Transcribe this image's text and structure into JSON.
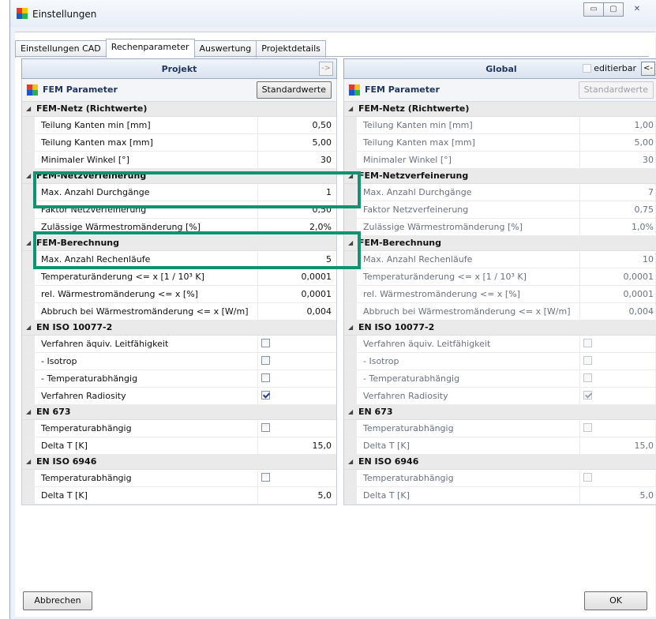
{
  "window": {
    "title": "Einstellungen",
    "buttons": {
      "minimize": "▭",
      "maximize": "▢",
      "close": "✕"
    }
  },
  "tabs": [
    "Einstellungen CAD",
    "Rechenparameter",
    "Auswertung",
    "Projektdetails"
  ],
  "active_tab": "Rechenparameter",
  "left": {
    "title": "Projekt",
    "arrow_label": "->",
    "subheader": "FEM Parameter",
    "standard_button": "Standardwerte",
    "categories": [
      {
        "name": "FEM-Netz (Richtwerte)",
        "rows": [
          {
            "label": "Teilung Kanten min [mm]",
            "value": "0,50"
          },
          {
            "label": "Teilung Kanten max [mm]",
            "value": "5,00"
          },
          {
            "label": "Minimaler Winkel [°]",
            "value": "30"
          }
        ]
      },
      {
        "name": "FEM-Netzverfeinerung",
        "rows": [
          {
            "label": "Max. Anzahl Durchgänge",
            "value": "1"
          },
          {
            "label": "Faktor Netzverfeinerung",
            "value": "0,50"
          },
          {
            "label": "Zulässige Wärmestromänderung [%]",
            "value": "2,0%"
          }
        ]
      },
      {
        "name": "FEM-Berechnung",
        "rows": [
          {
            "label": "Max. Anzahl Rechenläufe",
            "value": "5"
          },
          {
            "label": "Temperaturänderung <= x [1 / 10³ K]",
            "value": "0,0001"
          },
          {
            "label": "rel. Wärmestromänderung <= x [%]",
            "value": "0,0001"
          },
          {
            "label": "Abbruch bei Wärmestromänderung <= x [W/m]",
            "value": "0,004"
          }
        ]
      },
      {
        "name": "EN ISO 10077-2",
        "rows": [
          {
            "label": "Verfahren äquiv. Leitfähigkeit",
            "checked": false
          },
          {
            "label": "- Isotrop",
            "checked": false
          },
          {
            "label": "- Temperaturabhängig",
            "checked": false
          },
          {
            "label": "Verfahren Radiosity",
            "checked": true
          }
        ]
      },
      {
        "name": "EN 673",
        "rows": [
          {
            "label": "Temperaturabhängig",
            "checked": false
          },
          {
            "label": "Delta T [K]",
            "value": "15,0"
          }
        ]
      },
      {
        "name": "EN ISO 6946",
        "rows": [
          {
            "label": "Temperaturabhängig",
            "checked": false
          },
          {
            "label": "Delta T [K]",
            "value": "5,0"
          }
        ]
      }
    ]
  },
  "right": {
    "title": "Global",
    "editable_label": "editierbar",
    "arrow_label": "<-",
    "subheader": "FEM Parameter",
    "standard_button": "Standardwerte",
    "categories": [
      {
        "name": "FEM-Netz (Richtwerte)",
        "rows": [
          {
            "label": "Teilung Kanten min [mm]",
            "value": "1,00"
          },
          {
            "label": "Teilung Kanten max [mm]",
            "value": "5,00"
          },
          {
            "label": "Minimaler Winkel [°]",
            "value": "30"
          }
        ]
      },
      {
        "name": "FEM-Netzverfeinerung",
        "rows": [
          {
            "label": "Max. Anzahl Durchgänge",
            "value": "7"
          },
          {
            "label": "Faktor Netzverfeinerung",
            "value": "0,75"
          },
          {
            "label": "Zulässige Wärmestromänderung [%]",
            "value": "1,0%"
          }
        ]
      },
      {
        "name": "FEM-Berechnung",
        "rows": [
          {
            "label": "Max. Anzahl Rechenläufe",
            "value": "10"
          },
          {
            "label": "Temperaturänderung <= x [1 / 10³ K]",
            "value": "0,0001"
          },
          {
            "label": "rel. Wärmestromänderung <= x [%]",
            "value": "0,0001"
          },
          {
            "label": "Abbruch bei Wärmestromänderung <= x [W/m]",
            "value": "0,004"
          }
        ]
      },
      {
        "name": "EN ISO 10077-2",
        "rows": [
          {
            "label": "Verfahren äquiv. Leitfähigkeit",
            "checked": false
          },
          {
            "label": "- Isotrop",
            "checked": false
          },
          {
            "label": "- Temperaturabhängig",
            "checked": false
          },
          {
            "label": "Verfahren Radiosity",
            "checked": true
          }
        ]
      },
      {
        "name": "EN 673",
        "rows": [
          {
            "label": "Temperaturabhängig",
            "checked": false
          },
          {
            "label": "Delta T [K]",
            "value": "15,0"
          }
        ]
      },
      {
        "name": "EN ISO 6946",
        "rows": [
          {
            "label": "Temperaturabhängig",
            "checked": false
          },
          {
            "label": "Delta T [K]",
            "value": "5,0"
          }
        ]
      }
    ]
  },
  "footer": {
    "cancel": "Abbrechen",
    "ok": "OK"
  },
  "colors": {
    "highlight": "#119271",
    "header_text": "#20365e"
  }
}
